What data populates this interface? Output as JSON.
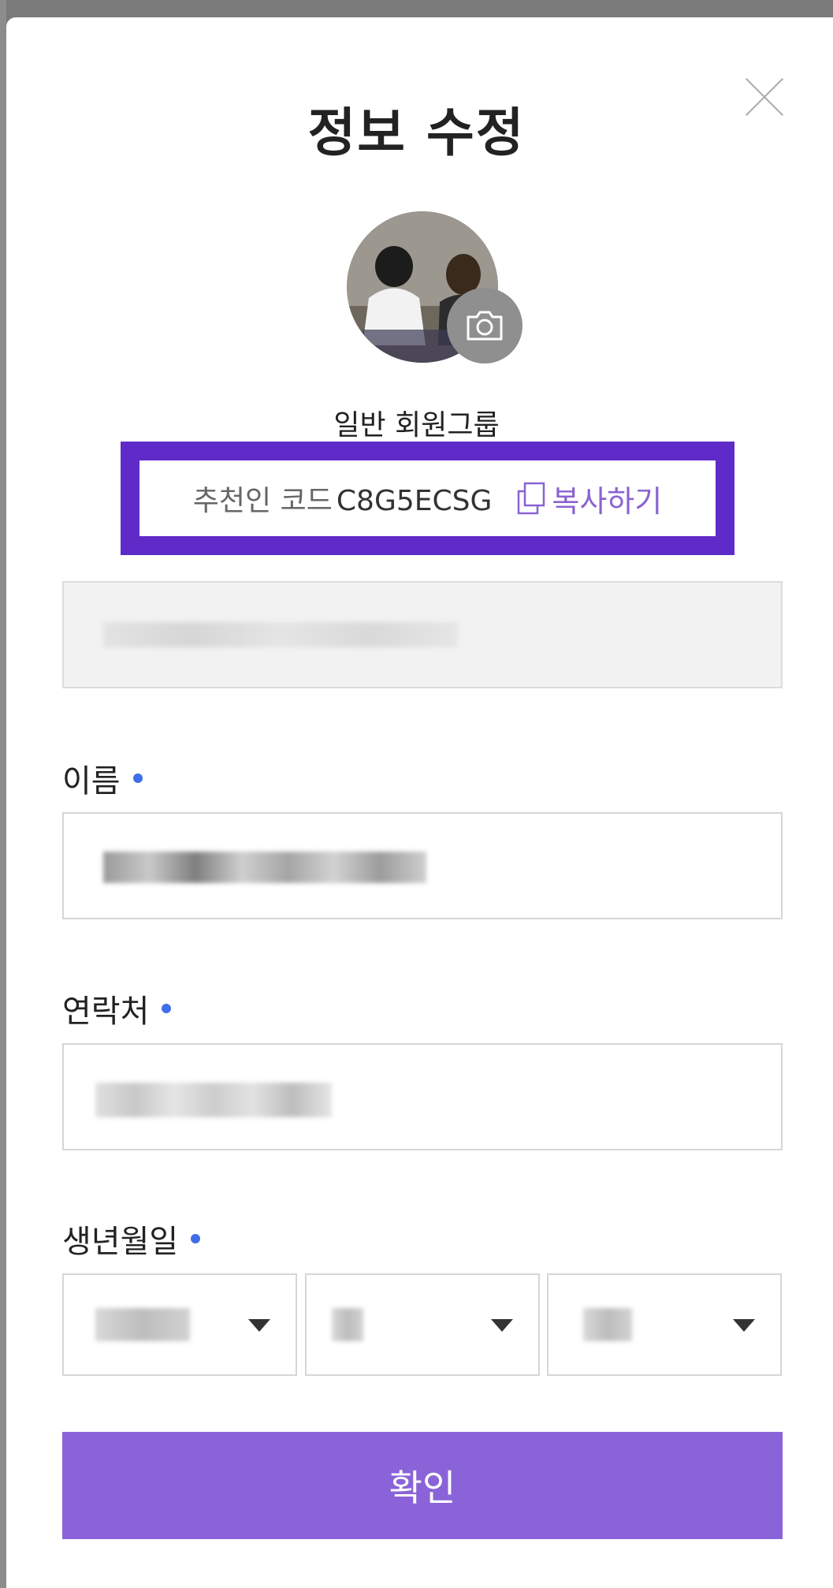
{
  "modal": {
    "title": "정보 수정",
    "close_icon": "close-icon",
    "camera_icon": "camera-icon"
  },
  "profile": {
    "group": "일반 회원그룹"
  },
  "referral": {
    "label": "추천인 코드",
    "code": "C8G5ECSG",
    "copy_label": "복사하기",
    "copy_icon": "copy-icon",
    "highlight_color": "#5f2bc8"
  },
  "form": {
    "name_label": "이름",
    "phone_label": "연락처",
    "birth_label": "생년월일",
    "required_dot_color": "#3f6ee8"
  },
  "confirm_label": "확인",
  "colors": {
    "accent": "#8a63d8"
  }
}
